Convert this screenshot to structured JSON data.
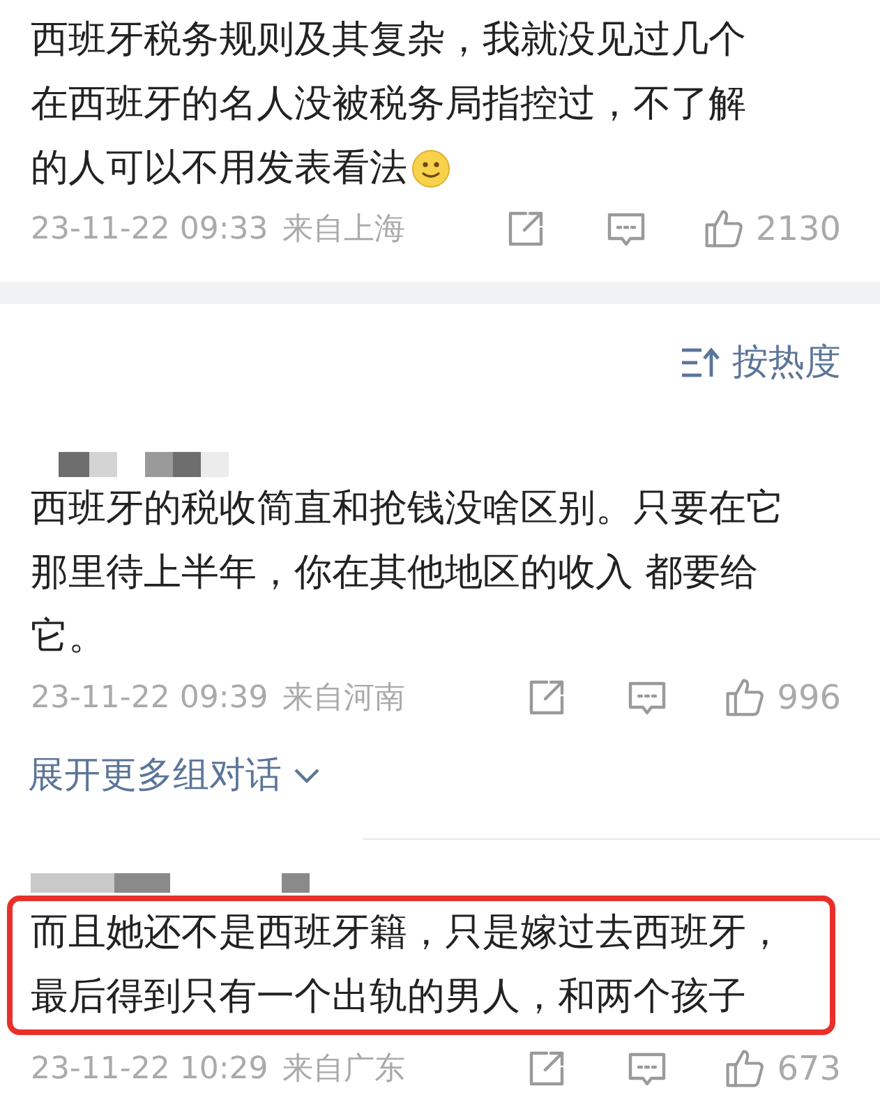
{
  "comments": [
    {
      "username_blurred": false,
      "highlighted": false,
      "lines": [
        "西班牙税务规则及其复杂，我就没见过几个",
        "在西班牙的名人没被税务局指控过，不了解",
        "的人可以不用发表看法"
      ],
      "smile_emoji": true,
      "time": "23-11-22 09:33",
      "location": "来自上海",
      "likes": "2130"
    },
    {
      "kind": "sort",
      "label": "按热度"
    },
    {
      "username_blurred": true,
      "highlighted": false,
      "lines": [
        "西班牙的税收简直和抢钱没啥区别。只要在它",
        "那里待上半年，你在其他地区的收入 都要给",
        "它。"
      ],
      "time": "23-11-22 09:39",
      "location": "来自河南",
      "likes": "996"
    },
    {
      "kind": "expand",
      "label": "展开更多组对话"
    },
    {
      "username_blurred": true,
      "highlighted": true,
      "lines": [
        "而且她还不是西班牙籍，只是嫁过去西班牙，",
        "最后得到只有一个出轨的男人，和两个孩子"
      ],
      "time": "23-11-22 10:29",
      "location": "来自广东",
      "likes": "673"
    }
  ]
}
